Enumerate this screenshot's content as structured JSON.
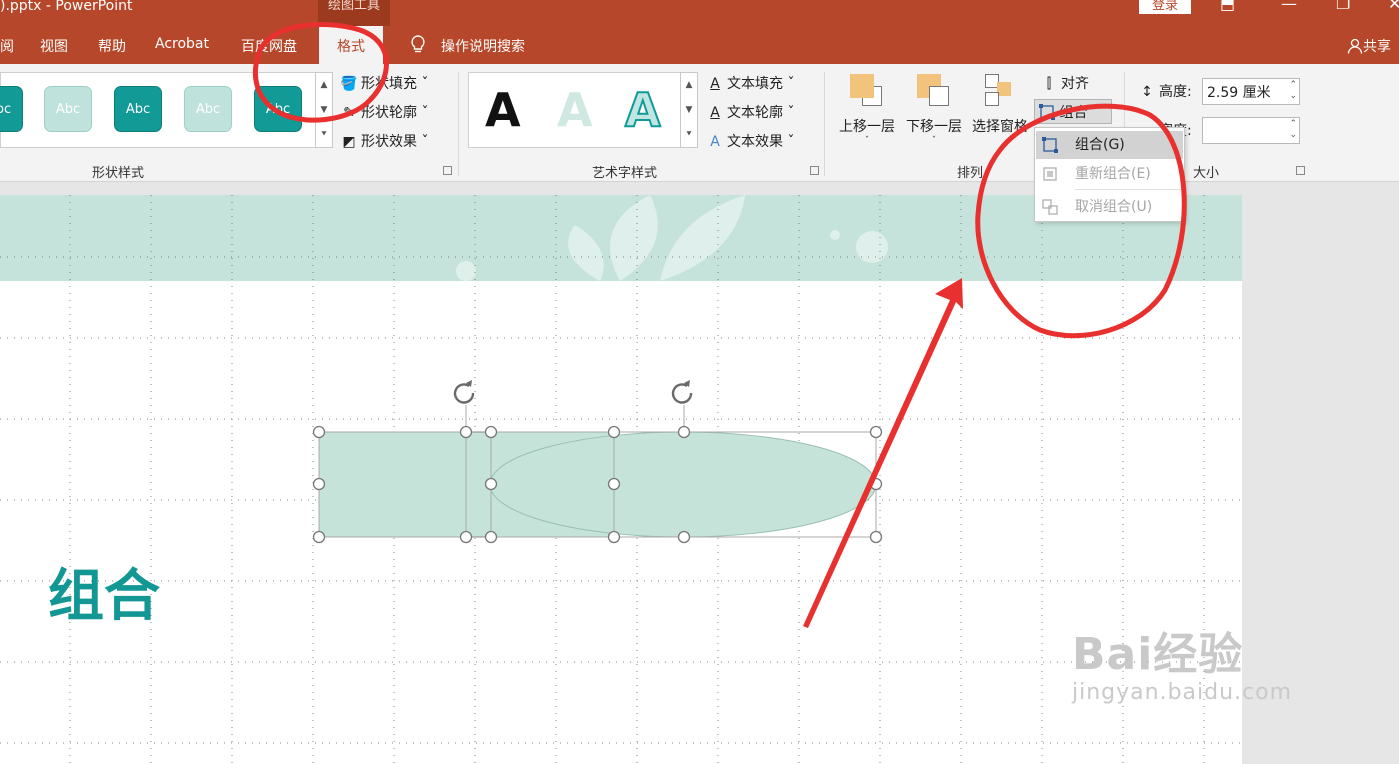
{
  "titlebar": {
    "title": ").pptx  -  PowerPoint",
    "context_tab": "绘图工具",
    "login_label": "登录"
  },
  "tabs": [
    {
      "label": "阅"
    },
    {
      "label": "视图"
    },
    {
      "label": "帮助"
    },
    {
      "label": "Acrobat"
    },
    {
      "label": "百度网盘"
    },
    {
      "label": "格式"
    },
    {
      "label": "操作说明搜索"
    }
  ],
  "share_label": "共享",
  "ribbon": {
    "shape_styles": {
      "group_label": "形状样式",
      "swatch_text": "Abc",
      "fill_label": "形状填充",
      "outline_label": "形状轮廓",
      "effect_label": "形状效果"
    },
    "wordart": {
      "group_label": "艺术字样式",
      "letter": "A",
      "fill_label": "文本填充",
      "outline_label": "文本轮廓",
      "effect_label": "文本效果"
    },
    "arrange": {
      "group_label": "排列",
      "bring_forward": "上移一层",
      "send_backward": "下移一层",
      "selection_pane": "选择窗格",
      "align_label": "对齐",
      "group_button": "组合"
    },
    "size": {
      "group_label": "大小",
      "height_label": "高度:",
      "height_value": "2.59 厘米",
      "width_label": "宽度:",
      "width_value": ""
    }
  },
  "group_menu": [
    {
      "label": "组合(G)",
      "state": "hover"
    },
    {
      "label": "重新组合(E)",
      "state": "disabled"
    },
    {
      "label": "取消组合(U)",
      "state": "disabled"
    }
  ],
  "slide": {
    "title": "组合"
  },
  "watermark": {
    "main": "Bai经验",
    "sub": "jingyan.baidu.com"
  },
  "colors": {
    "accent": "#b7472a",
    "teal": "#139795",
    "shape_fill": "#c5e3d8",
    "annotation": "#e8302f"
  }
}
